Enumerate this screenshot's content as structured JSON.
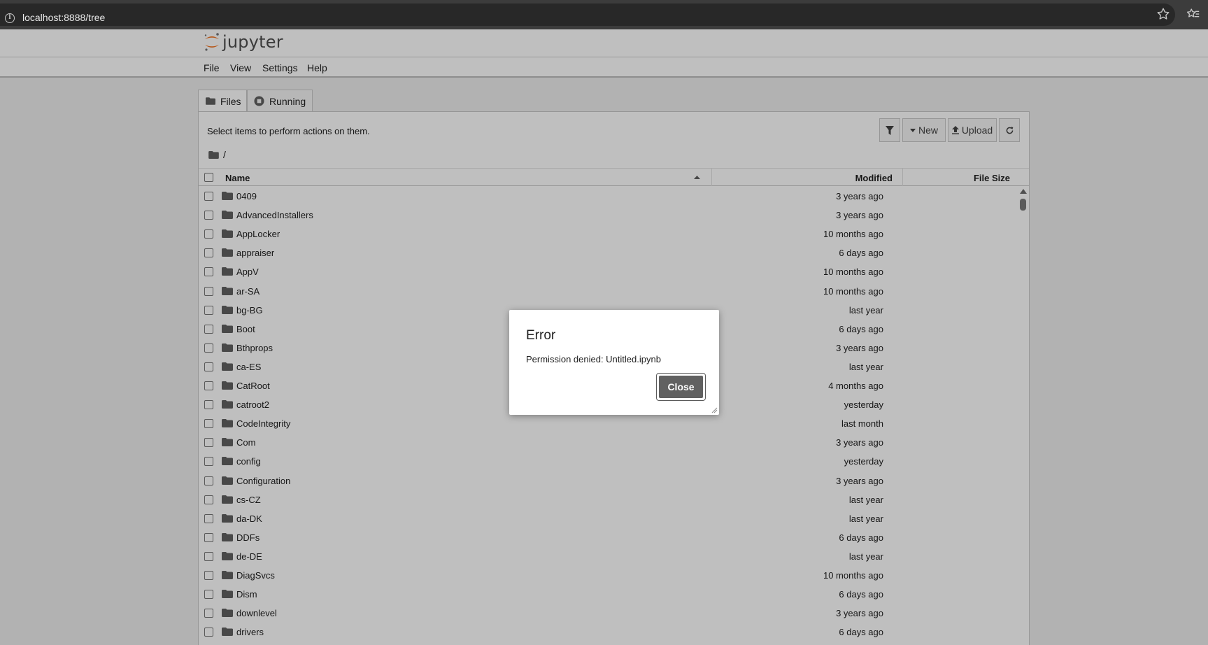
{
  "browser": {
    "url": "localhost:8888/tree"
  },
  "app": {
    "logo_text": "jupyter",
    "brand_color": "#f37726"
  },
  "menu": [
    "File",
    "View",
    "Settings",
    "Help"
  ],
  "tabs": [
    {
      "label": "Files",
      "active": true
    },
    {
      "label": "Running",
      "active": false
    }
  ],
  "toolbar": {
    "hint": "Select items to perform actions on them.",
    "new_label": "New",
    "upload_label": "Upload"
  },
  "breadcrumb": {
    "path": "/"
  },
  "columns": {
    "name": "Name",
    "modified": "Modified",
    "file_size": "File Size"
  },
  "files": [
    {
      "name": "0409",
      "modified": "3 years ago"
    },
    {
      "name": "AdvancedInstallers",
      "modified": "3 years ago"
    },
    {
      "name": "AppLocker",
      "modified": "10 months ago"
    },
    {
      "name": "appraiser",
      "modified": "6 days ago"
    },
    {
      "name": "AppV",
      "modified": "10 months ago"
    },
    {
      "name": "ar-SA",
      "modified": "10 months ago"
    },
    {
      "name": "bg-BG",
      "modified": "last year"
    },
    {
      "name": "Boot",
      "modified": "6 days ago"
    },
    {
      "name": "Bthprops",
      "modified": "3 years ago"
    },
    {
      "name": "ca-ES",
      "modified": "last year"
    },
    {
      "name": "CatRoot",
      "modified": "4 months ago"
    },
    {
      "name": "catroot2",
      "modified": "yesterday"
    },
    {
      "name": "CodeIntegrity",
      "modified": "last month"
    },
    {
      "name": "Com",
      "modified": "3 years ago"
    },
    {
      "name": "config",
      "modified": "yesterday"
    },
    {
      "name": "Configuration",
      "modified": "3 years ago"
    },
    {
      "name": "cs-CZ",
      "modified": "last year"
    },
    {
      "name": "da-DK",
      "modified": "last year"
    },
    {
      "name": "DDFs",
      "modified": "6 days ago"
    },
    {
      "name": "de-DE",
      "modified": "last year"
    },
    {
      "name": "DiagSvcs",
      "modified": "10 months ago"
    },
    {
      "name": "Dism",
      "modified": "6 days ago"
    },
    {
      "name": "downlevel",
      "modified": "3 years ago"
    },
    {
      "name": "drivers",
      "modified": "6 days ago"
    }
  ],
  "dialog": {
    "title": "Error",
    "message": "Permission denied: Untitled.ipynb",
    "close_label": "Close"
  }
}
